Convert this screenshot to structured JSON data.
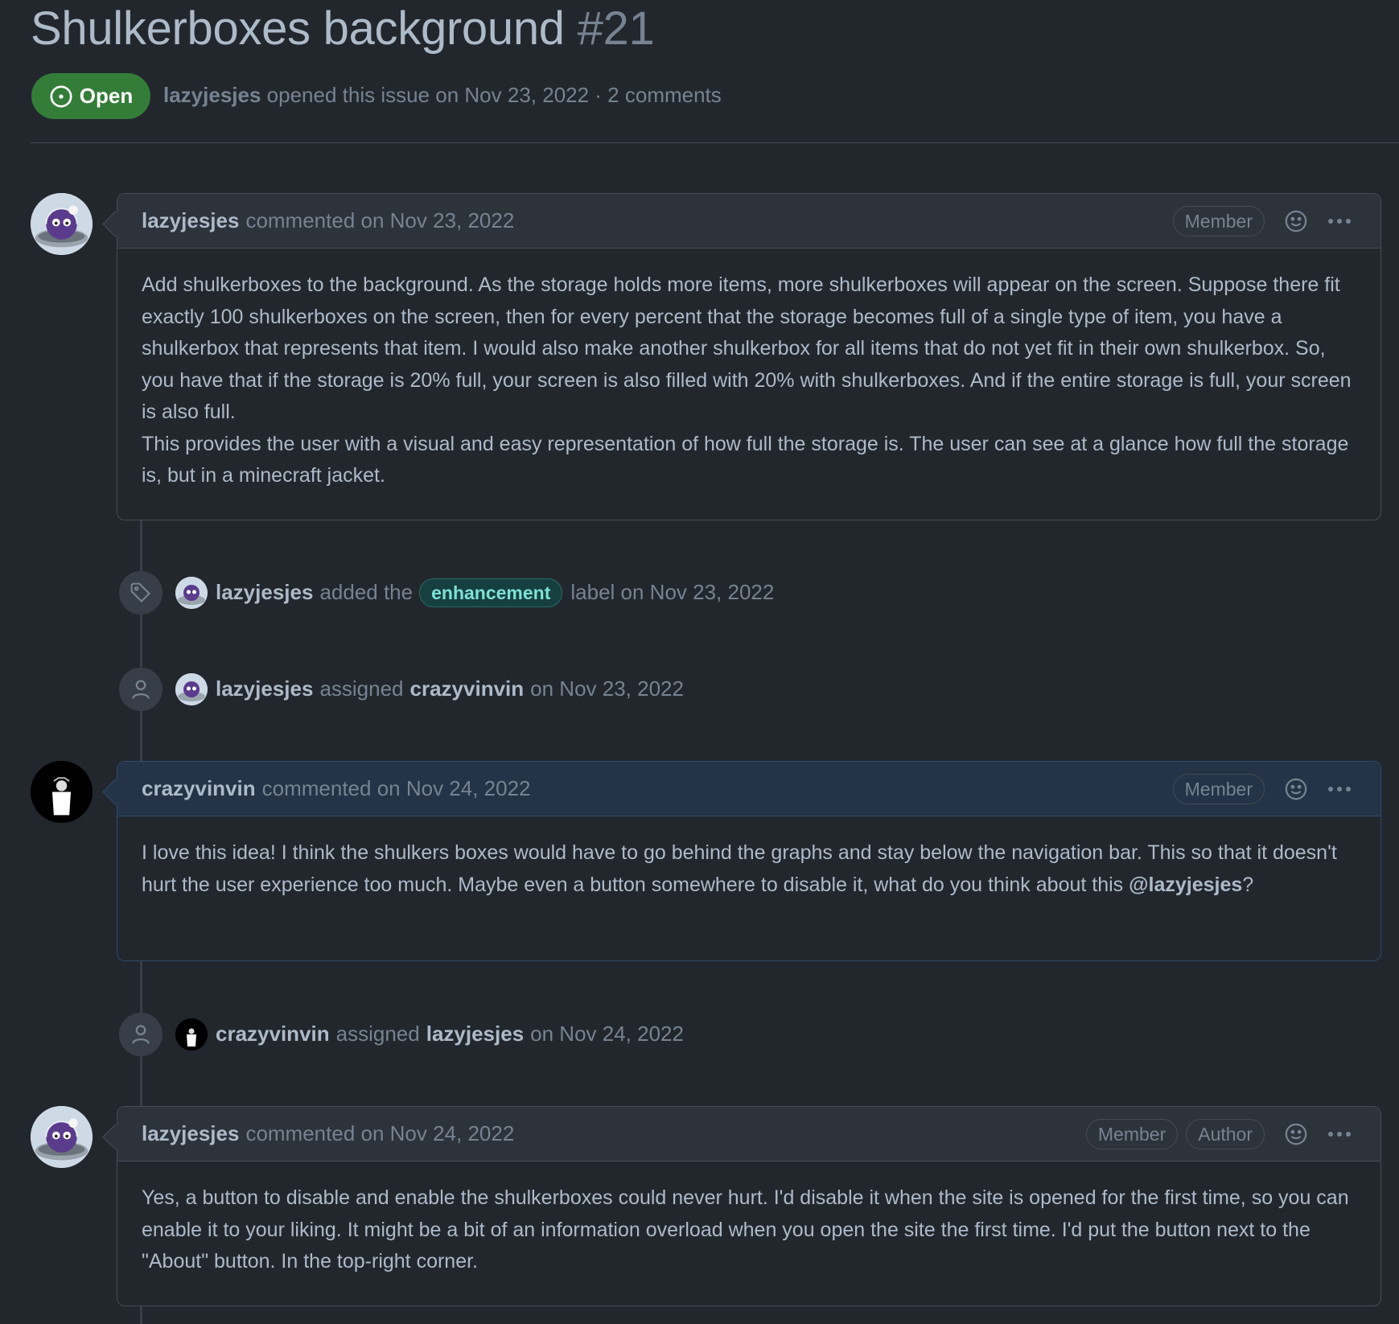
{
  "issue": {
    "title": "Shulkerboxes background",
    "number": "#21",
    "state": "Open",
    "author": "lazyjesjes",
    "meta_text": "opened this issue on Nov 23, 2022 · 2 comments"
  },
  "comments": [
    {
      "author": "lazyjesjes",
      "action": "commented on Nov 23, 2022",
      "badges": [
        "Member"
      ],
      "paragraphs": [
        "Add shulkerboxes to the background. As the storage holds more items, more shulkerboxes will appear on the screen. Suppose there fit exactly 100 shulkerboxes on the screen, then for every percent that the storage becomes full of a single type of item, you have a shulkerbox that represents that item. I would also make another shulkerbox for all items that do not yet fit in their own shulkerbox. So, you have that if the storage is 20% full, your screen is also filled with 20% with shulkerboxes. And if the entire storage is full, your screen is also full.",
        "This provides the user with a visual and easy representation of how full the storage is. The user can see at a glance how full the storage is, but in a minecraft jacket."
      ]
    },
    {
      "author": "crazyvinvin",
      "action": "commented on Nov 24, 2022",
      "badges": [
        "Member"
      ],
      "text_before_mention": "I love this idea! I think the shulkers boxes would have to go behind the graphs and stay below the navigation bar. This so that it doesn't hurt the user experience too much. Maybe even a button somewhere to disable it, what do you think about this ",
      "mention": "@lazyjesjes",
      "text_after_mention": "?"
    },
    {
      "author": "lazyjesjes",
      "action": "commented on Nov 24, 2022",
      "badges": [
        "Member",
        "Author"
      ],
      "paragraphs": [
        "Yes, a button to disable and enable the shulkerboxes could never hurt. I'd disable it when the site is opened for the first time, so you can enable it to your liking. It might be a bit of an information overload when you open the site the first time. I'd put the button next to the \"About\" button. In the top-right corner."
      ]
    }
  ],
  "events": [
    {
      "icon": "tag-icon",
      "actor": "lazyjesjes",
      "text1": "added the",
      "label": "enhancement",
      "text2": "label on Nov 23, 2022"
    },
    {
      "icon": "person-icon",
      "actor": "lazyjesjes",
      "text1": "assigned",
      "target": "crazyvinvin",
      "text2": "on Nov 23, 2022"
    },
    {
      "icon": "person-icon",
      "actor": "crazyvinvin",
      "text1": "assigned",
      "target": "lazyjesjes",
      "text2": "on Nov 24, 2022"
    }
  ],
  "colors": {
    "background": "#22272e",
    "open_badge": "#347d39",
    "label_enhancement": "#15403f"
  }
}
